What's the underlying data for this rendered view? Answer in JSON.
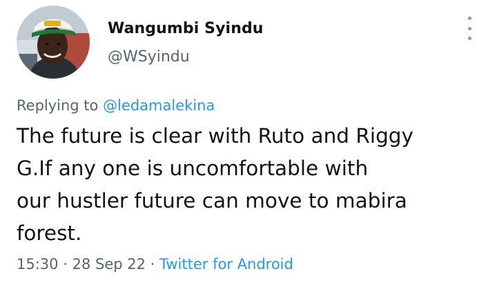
{
  "author": {
    "display_name": "Wangumbi Syindu",
    "handle": "@WSyindu"
  },
  "reply": {
    "prefix": "Replying to",
    "target": "@ledamalekina"
  },
  "tweet": {
    "lines": [
      "The future is clear with Ruto and Riggy",
      "G.If any one is uncomfortable with",
      "our hustler future can move to mabira",
      "forest."
    ]
  },
  "meta": {
    "time": "15:30",
    "sep1": "·",
    "date": "28 Sep 22",
    "sep2": "·",
    "source": "Twitter for Android"
  },
  "icons": {
    "menu": "more-vertical-icon"
  },
  "colors": {
    "link": "#1d9bf0",
    "secondary_text": "#536471",
    "primary_text": "#0f1419"
  }
}
